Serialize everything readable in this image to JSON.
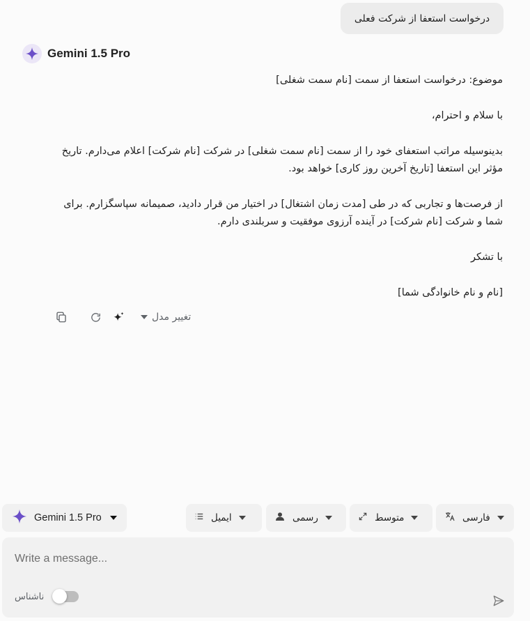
{
  "user_message": "درخواست استعفا از شرکت فعلی",
  "assistant": {
    "model_name": "Gemini 1.5 Pro",
    "paragraphs": [
      "موضوع: درخواست استعفا از سمت [نام سمت شغلی]",
      "با سلام و احترام،",
      "بدینوسیله مراتب استعفای خود را از سمت [نام سمت شغلی] در شرکت [نام شرکت] اعلام می‌دارم. تاریخ مؤثر این استعفا [تاریخ آخرین روز کاری] خواهد بود.",
      "از فرصت‌ها و تجاربی که در طی [مدت زمان اشتغال] در اختیار من قرار دادید، صمیمانه سپاسگزارم. برای شما و شرکت [نام شرکت] در آینده آرزوی موفقیت و سربلندی دارم.",
      "با تشکر",
      "[نام و نام خانوادگی شما]"
    ],
    "change_model_label": "تغییر مدل"
  },
  "toolbar": {
    "model_label": "Gemini 1.5 Pro",
    "format_label": "ایمیل",
    "tone_label": "رسمی",
    "length_label": "متوسط",
    "language_label": "فارسی"
  },
  "composer": {
    "placeholder": "Write a message...",
    "incognito_label": "ناشناس"
  },
  "colors": {
    "accent": "#6b4fc8",
    "bubble": "#ececec",
    "surface": "#f1f1f1"
  },
  "icons": [
    "sparkle-icon",
    "copy-icon",
    "refresh-icon",
    "sparkles-icon",
    "list-icon",
    "person-icon",
    "expand-icon",
    "translate-icon",
    "send-icon"
  ]
}
